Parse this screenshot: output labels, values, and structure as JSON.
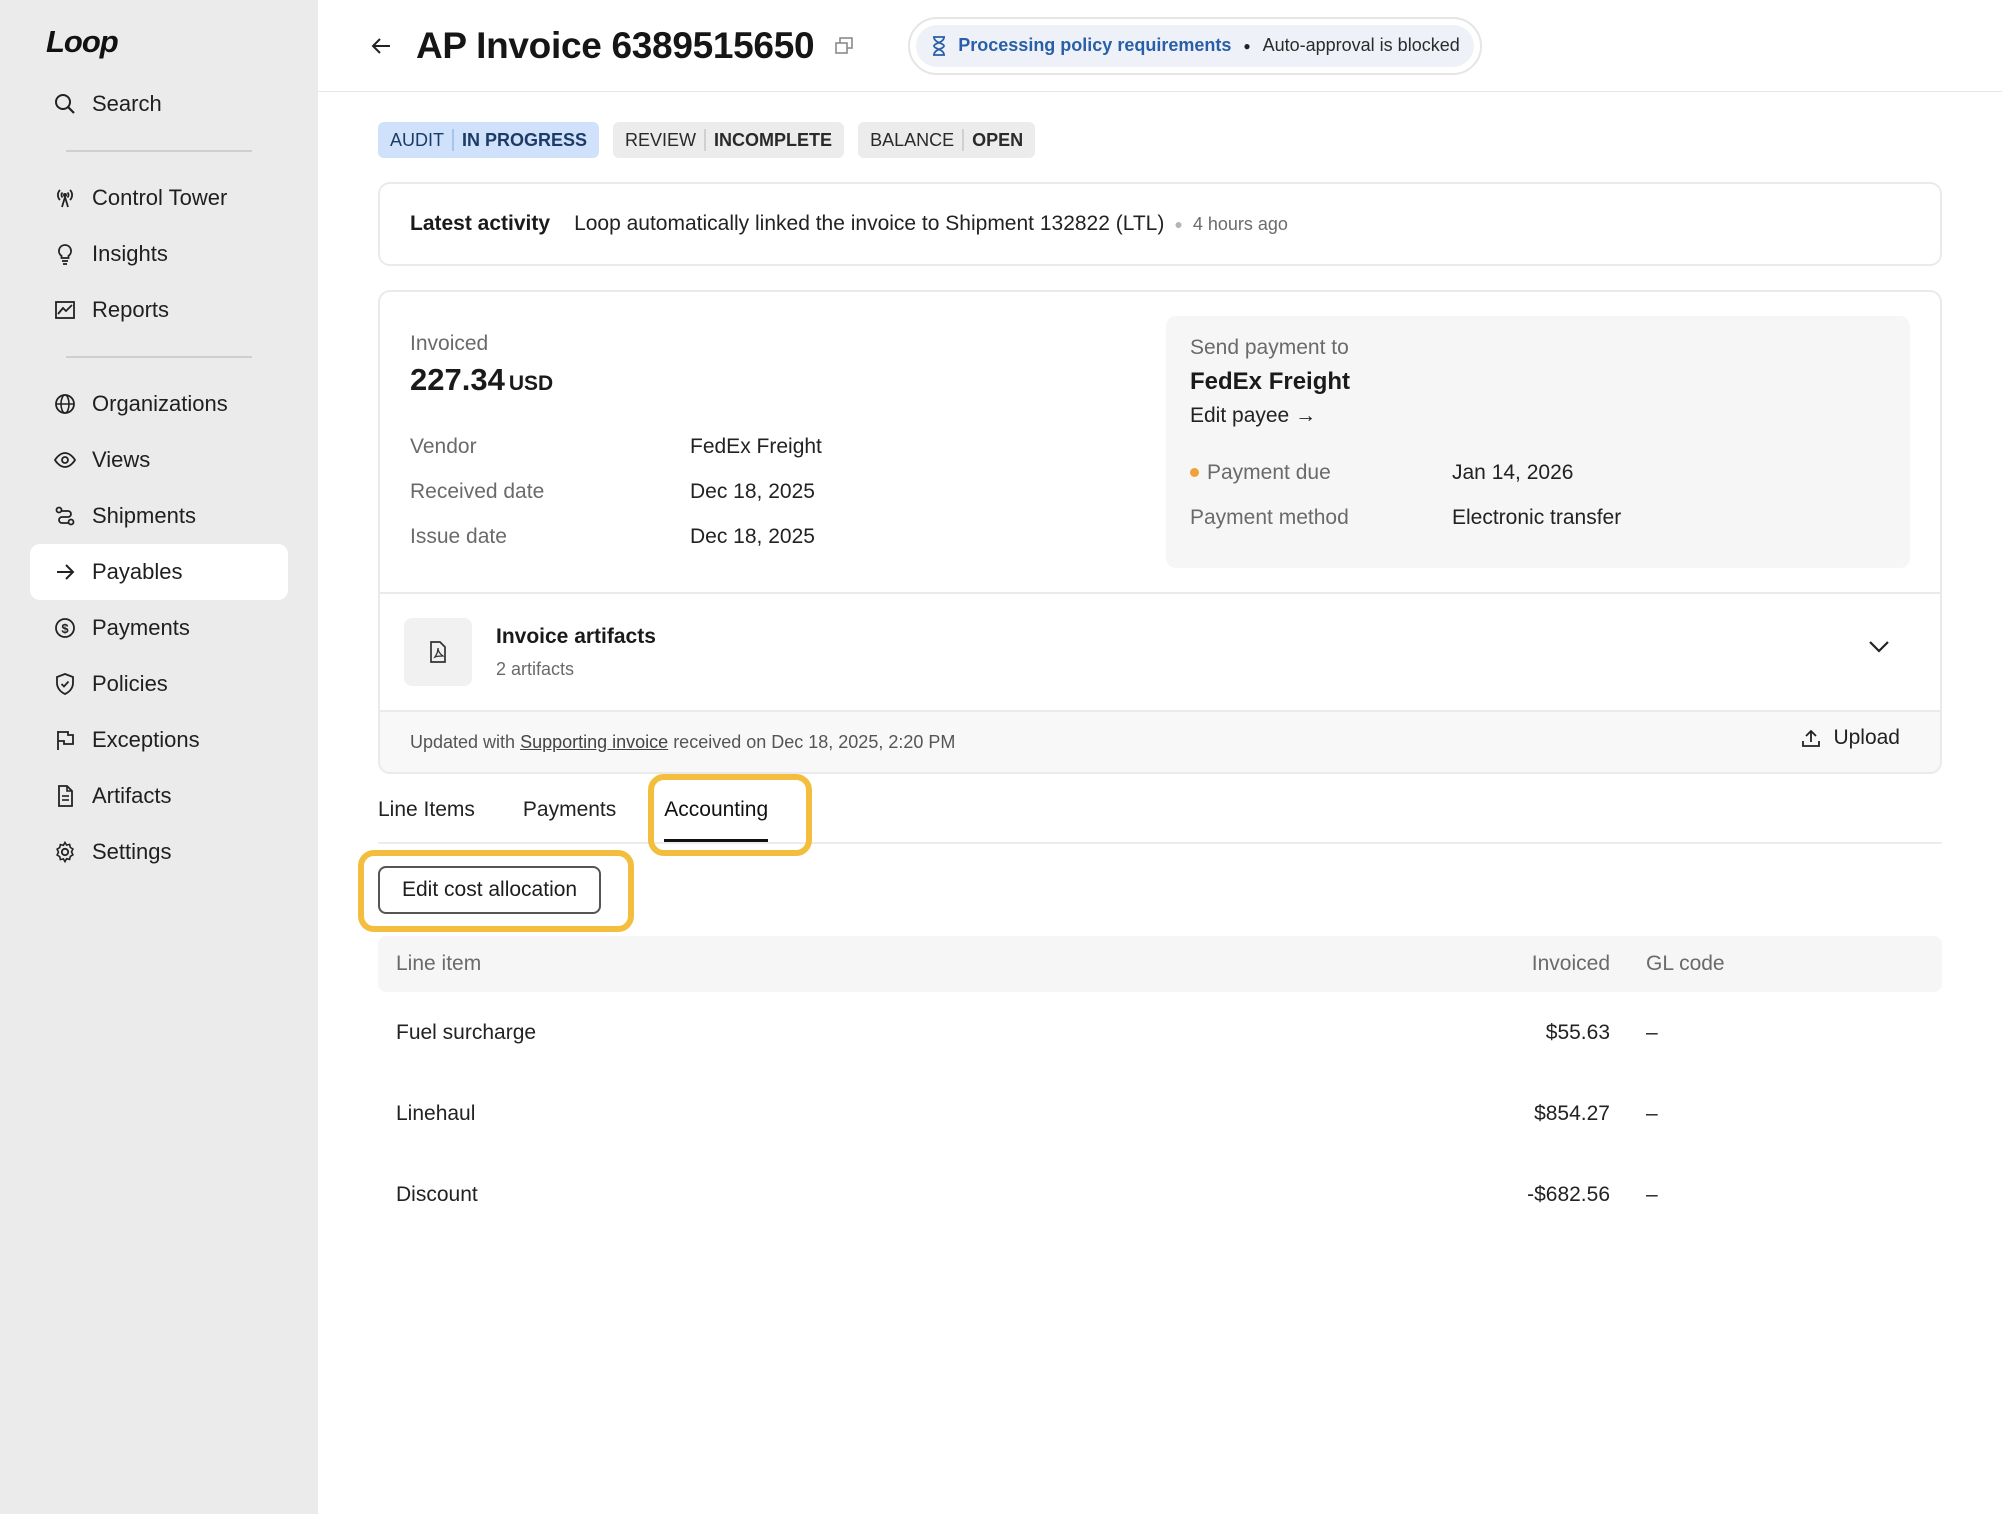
{
  "app": {
    "logo": "Loop"
  },
  "sidebar": {
    "search_label": "Search",
    "items_group1": [
      {
        "label": "Control Tower",
        "icon": "radio-tower-icon"
      },
      {
        "label": "Insights",
        "icon": "lightbulb-icon"
      },
      {
        "label": "Reports",
        "icon": "chart-icon"
      }
    ],
    "items_group2": [
      {
        "label": "Organizations",
        "icon": "globe-icon"
      },
      {
        "label": "Views",
        "icon": "eye-icon"
      },
      {
        "label": "Shipments",
        "icon": "route-icon"
      },
      {
        "label": "Payables",
        "icon": "arrow-right-icon",
        "active": true
      },
      {
        "label": "Payments",
        "icon": "dollar-circle-icon"
      },
      {
        "label": "Policies",
        "icon": "shield-check-icon"
      },
      {
        "label": "Exceptions",
        "icon": "flag-icon"
      },
      {
        "label": "Artifacts",
        "icon": "file-icon"
      },
      {
        "label": "Settings",
        "icon": "gear-icon"
      }
    ]
  },
  "header": {
    "title": "AP Invoice 6389515650",
    "policy_status": "Processing policy requirements",
    "policy_note": "Auto-approval is blocked"
  },
  "statuses": [
    {
      "key": "AUDIT",
      "value": "IN PROGRESS",
      "color": "#cfe1fb"
    },
    {
      "key": "REVIEW",
      "value": "INCOMPLETE",
      "color": "#ececec"
    },
    {
      "key": "BALANCE",
      "value": "OPEN",
      "color": "#ececec"
    }
  ],
  "activity": {
    "label": "Latest activity",
    "text": "Loop automatically linked the invoice to Shipment 132822 (LTL)",
    "time": "4 hours ago"
  },
  "invoice": {
    "invoiced_label": "Invoiced",
    "amount": "227.34",
    "currency": "USD",
    "vendor_label": "Vendor",
    "vendor": "FedEx Freight",
    "received_label": "Received date",
    "received": "Dec 18, 2025",
    "issue_label": "Issue date",
    "issue": "Dec 18, 2025"
  },
  "payment": {
    "send_to_label": "Send payment to",
    "payee": "FedEx Freight",
    "edit_payee": "Edit payee →",
    "due_label": "Payment due",
    "due": "Jan 14, 2026",
    "method_label": "Payment method",
    "method": "Electronic transfer"
  },
  "artifacts": {
    "title": "Invoice artifacts",
    "count": "2 artifacts",
    "updated_prefix": "Updated with",
    "updated_link": "Supporting invoice",
    "updated_suffix": "received on Dec 18, 2025, 2:20 PM",
    "upload": "Upload"
  },
  "tabs": [
    {
      "label": "Line Items"
    },
    {
      "label": "Payments"
    },
    {
      "label": "Accounting",
      "active": true
    }
  ],
  "accounting": {
    "edit_button": "Edit cost allocation",
    "columns": {
      "item": "Line item",
      "invoiced": "Invoiced",
      "gl": "GL code"
    },
    "rows": [
      {
        "item": "Fuel surcharge",
        "invoiced": "$55.63",
        "gl": "–"
      },
      {
        "item": "Linehaul",
        "invoiced": "$854.27",
        "gl": "–"
      },
      {
        "item": "Discount",
        "invoiced": "-$682.56",
        "gl": "–"
      }
    ]
  },
  "colors": {
    "highlight": "#f3bd3e",
    "accent_blue": "#2a5fa8",
    "due_dot": "#f0a13a"
  }
}
